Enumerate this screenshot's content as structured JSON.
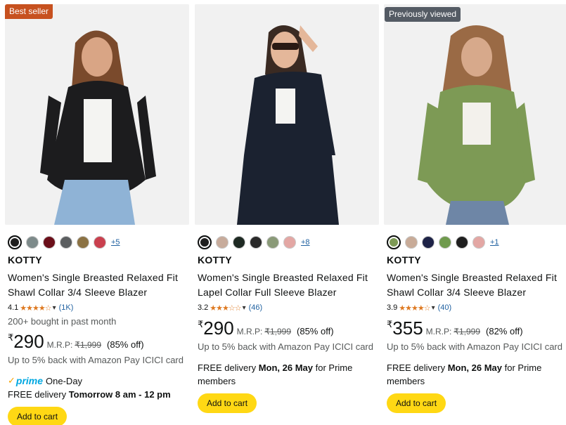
{
  "products": [
    {
      "badge": "Best seller",
      "colors": [
        "#1f1f1f",
        "#7d8a8a",
        "#6b0f1a",
        "#5b5e60",
        "#8b7244",
        "#c9404e"
      ],
      "more_colors": "+5",
      "brand": "KOTTY",
      "title_line1": "Women's Single Breasted Relaxed Fit",
      "title_line2": "Shawl Collar 3/4 Sleeve Blazer",
      "rating": "4.1",
      "stars": "★★★★☆",
      "reviews": "(1K)",
      "bought": "200+ bought in past month",
      "currency": "₹",
      "price": "290",
      "mrp_label": "M.R.P:",
      "mrp": "₹1,999",
      "discount": "(85% off)",
      "cashback": "Up to 5% back with Amazon Pay ICICI card",
      "prime_check": "✓",
      "prime": "prime",
      "prime_speed": "One-Day",
      "delivery_prefix": "FREE delivery",
      "delivery_date": "Tomorrow 8 am - 12 pm",
      "add_to_cart": "Add to cart"
    },
    {
      "colors": [
        "#1f1f1f",
        "#c7ab9b",
        "#1e2a23",
        "#2a2a2a",
        "#8a9a78",
        "#e3a7a4"
      ],
      "more_colors": "+8",
      "brand": "KOTTY",
      "title_line1": "Women's Single Breasted Relaxed Fit",
      "title_line2": "Lapel Collar Full Sleeve Blazer",
      "rating": "3.2",
      "stars": "★★★☆☆",
      "reviews": "(46)",
      "currency": "₹",
      "price": "290",
      "mrp_label": "M.R.P:",
      "mrp": "₹1,999",
      "discount": "(85% off)",
      "cashback": "Up to 5% back with Amazon Pay ICICI card",
      "delivery_prefix": "FREE delivery",
      "delivery_date": "Mon, 26 May",
      "delivery_suffix": "for Prime",
      "delivery_line2": "members",
      "add_to_cart": "Add to cart"
    },
    {
      "badge": "Previously viewed",
      "colors": [
        "#7d9a55",
        "#c8ab98",
        "#1e2347",
        "#6f9a4d",
        "#1f1f1f",
        "#e3a7a4"
      ],
      "more_colors": "+1",
      "brand": "KOTTY",
      "title_line1": "Women's Single Breasted Relaxed Fit",
      "title_line2": "Shawl Collar 3/4 Sleeve Blazer",
      "rating": "3.9",
      "stars": "★★★★☆",
      "reviews": "(40)",
      "currency": "₹",
      "price": "355",
      "mrp_label": "M.R.P:",
      "mrp": "₹1,999",
      "discount": "(82% off)",
      "cashback": "Up to 5% back with Amazon Pay ICICI card",
      "delivery_prefix": "FREE delivery",
      "delivery_date": "Mon, 26 May",
      "delivery_suffix": "for Prime",
      "delivery_line2": "members",
      "add_to_cart": "Add to cart"
    }
  ],
  "icons": {
    "chevron": "chevron-down-icon",
    "prime_check": "checkmark-icon"
  },
  "theme": {
    "button_yellow": "#ffd814",
    "link_blue": "#2162a1",
    "star_orange": "#de7921",
    "prime_blue": "#00a8e1",
    "best_seller": "#c7511f"
  }
}
